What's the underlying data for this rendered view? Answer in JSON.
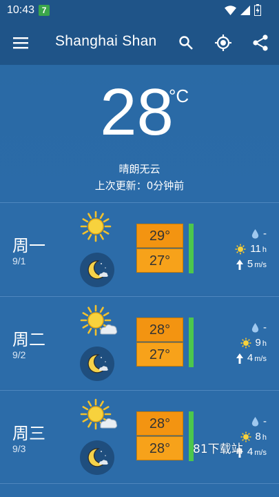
{
  "status_bar": {
    "time": "10:43",
    "badge": "7"
  },
  "app_bar": {
    "title": "Shanghai Shan",
    "menu_icon": "hamburger-menu-icon",
    "search_icon": "search-icon",
    "locate_icon": "gps-locate-icon",
    "share_icon": "share-icon"
  },
  "current": {
    "temperature": "28",
    "unit": "°C",
    "condition": "晴朗无云",
    "updated": "上次更新：0分钟前"
  },
  "forecast": [
    {
      "day": "周一",
      "date": "9/1",
      "day_icon": "sunny-icon",
      "night_icon": "clear-night-icon",
      "high": "29°",
      "low": "27°",
      "rain": "-",
      "sun_hours": "11",
      "sun_unit": "h",
      "wind": "5",
      "wind_unit": "m/s"
    },
    {
      "day": "周二",
      "date": "9/2",
      "day_icon": "partly-cloudy-icon",
      "night_icon": "clear-night-icon",
      "high": "28°",
      "low": "27°",
      "rain": "-",
      "sun_hours": "9",
      "sun_unit": "h",
      "wind": "4",
      "wind_unit": "m/s"
    },
    {
      "day": "周三",
      "date": "9/3",
      "day_icon": "partly-cloudy-icon",
      "night_icon": "clear-night-icon",
      "high": "28°",
      "low": "28°",
      "rain": "-",
      "sun_hours": "8",
      "sun_unit": "h",
      "wind": "4",
      "wind_unit": "m/s"
    }
  ],
  "watermark": "81下载站",
  "colors": {
    "bar": "#1f5488",
    "background": "#2b6aa6",
    "temp_high": "#f39411",
    "temp_low": "#f7a21a",
    "indicator": "#4cc74c"
  }
}
